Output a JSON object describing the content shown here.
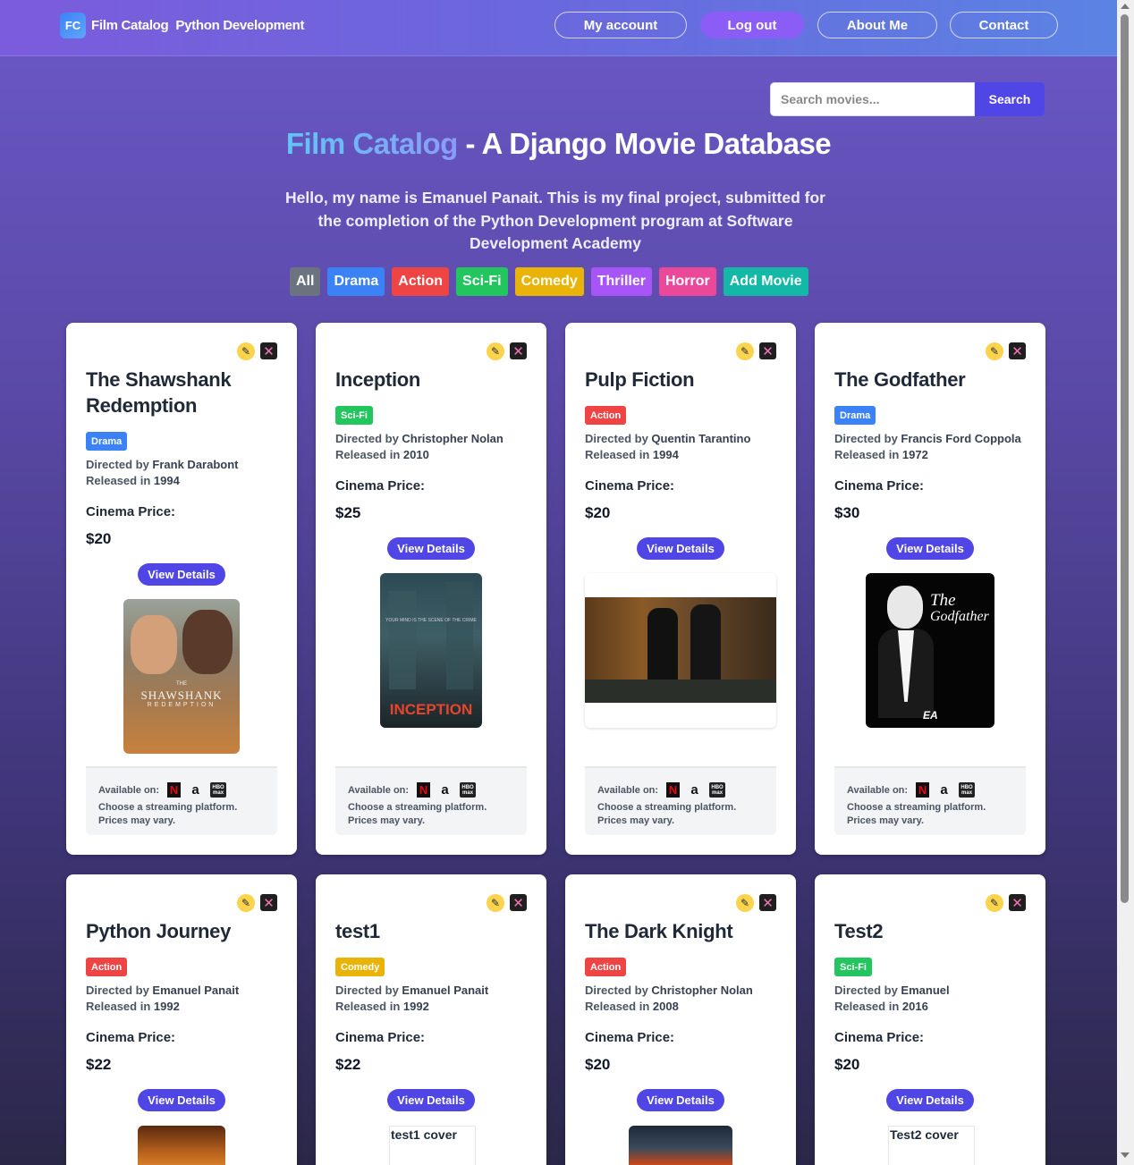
{
  "nav": {
    "logo": "FC",
    "brand": "Film Catalog",
    "subtitle": "Python Development",
    "buttons": [
      "My account",
      "Log out",
      "About Me",
      "Contact"
    ]
  },
  "search": {
    "placeholder": "Search movies...",
    "button": "Search"
  },
  "title": {
    "accent": "Film Catalog",
    "rest": " - A Django Movie Database"
  },
  "intro": "Hello, my name is Emanuel Panait. This is my final project, submitted for the completion of the Python Development program at Software Development Academy",
  "filters": [
    {
      "label": "All",
      "color": "#6b7280"
    },
    {
      "label": "Drama",
      "color": "#3b82f6"
    },
    {
      "label": "Action",
      "color": "#ef4444"
    },
    {
      "label": "Sci-Fi",
      "color": "#22c55e"
    },
    {
      "label": "Comedy",
      "color": "#eab308"
    },
    {
      "label": "Thriller",
      "color": "#a855f7"
    },
    {
      "label": "Horror",
      "color": "#ec4899"
    },
    {
      "label": "Add Movie",
      "color": "#14b8a6"
    }
  ],
  "card_common": {
    "directed_by": "Directed by ",
    "released_in": "Released in ",
    "price_label": "Cinema Price:",
    "details": "View Details",
    "available_on": "Available on:",
    "stream_note_1": "Choose a streaming platform.",
    "stream_note_2": "Prices may vary.",
    "netflix": "N",
    "amazon": "a",
    "hbo": "HBO max"
  },
  "movies": [
    {
      "title": "The Shawshank Redemption",
      "genre": "Drama",
      "genre_color": "#3b82f6",
      "director": "Frank Darabont",
      "year": "1994",
      "price": "$20"
    },
    {
      "title": "Inception",
      "genre": "Sci-Fi",
      "genre_color": "#22c55e",
      "director": "Christopher Nolan",
      "year": "2010",
      "price": "$25"
    },
    {
      "title": "Pulp Fiction",
      "genre": "Action",
      "genre_color": "#ef4444",
      "director": "Quentin Tarantino",
      "year": "1994",
      "price": "$20"
    },
    {
      "title": "The Godfather",
      "genre": "Drama",
      "genre_color": "#3b82f6",
      "director": "Francis Ford Coppola",
      "year": "1972",
      "price": "$30"
    },
    {
      "title": "Python Journey",
      "genre": "Action",
      "genre_color": "#ef4444",
      "director": "Emanuel Panait",
      "year": "1992",
      "price": "$22"
    },
    {
      "title": "test1",
      "genre": "Comedy",
      "genre_color": "#eab308",
      "director": "Emanuel Panait",
      "year": "1992",
      "price": "$22",
      "alt": "test1 cover"
    },
    {
      "title": "The Dark Knight",
      "genre": "Action",
      "genre_color": "#ef4444",
      "director": "Christopher Nolan",
      "year": "2008",
      "price": "$20"
    },
    {
      "title": "Test2",
      "genre": "Sci-Fi",
      "genre_color": "#22c55e",
      "director": "Emanuel",
      "year": "2016",
      "price": "$20",
      "alt": "Test2 cover"
    }
  ],
  "posters": {
    "shawshank": {
      "line1": "SHAWSHANK",
      "line2": "REDEMPTION",
      "the": "THE"
    },
    "inception": {
      "title": "INCEPTION",
      "tagline": "YOUR MIND IS THE SCENE OF THE CRIME"
    },
    "godfather": {
      "line1": "The",
      "line2": "Godfather",
      "ea": "EA"
    }
  }
}
